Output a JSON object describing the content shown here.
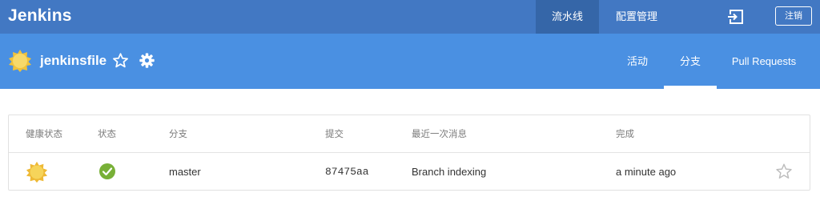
{
  "header": {
    "logo": "Jenkins",
    "nav": {
      "pipelines": "流水线",
      "administration": "配置管理"
    },
    "logout_label": "注销",
    "icons": {
      "exit": "exit-icon"
    }
  },
  "subheader": {
    "job_name": "jenkinsfile",
    "icons": {
      "weather": "sunny-weather-icon",
      "favorite": "star-outline-icon",
      "settings": "gear-icon"
    },
    "tabs": {
      "activity": "活动",
      "branches": "分支",
      "pull_requests": "Pull Requests"
    },
    "active_tab": "branches"
  },
  "branches_table": {
    "headers": {
      "health": "健康状态",
      "status": "状态",
      "branch": "分支",
      "commit": "提交",
      "message": "最近一次消息",
      "completed": "完成"
    },
    "rows": [
      {
        "health": "sunny",
        "status": "success",
        "branch": "master",
        "commit": "87475aa",
        "message": "Branch indexing",
        "completed": "a minute ago"
      }
    ]
  },
  "colors": {
    "topbar": "#4278c3",
    "subbar": "#4a90e2",
    "success": "#78b037",
    "sun": "#f5d34c"
  }
}
